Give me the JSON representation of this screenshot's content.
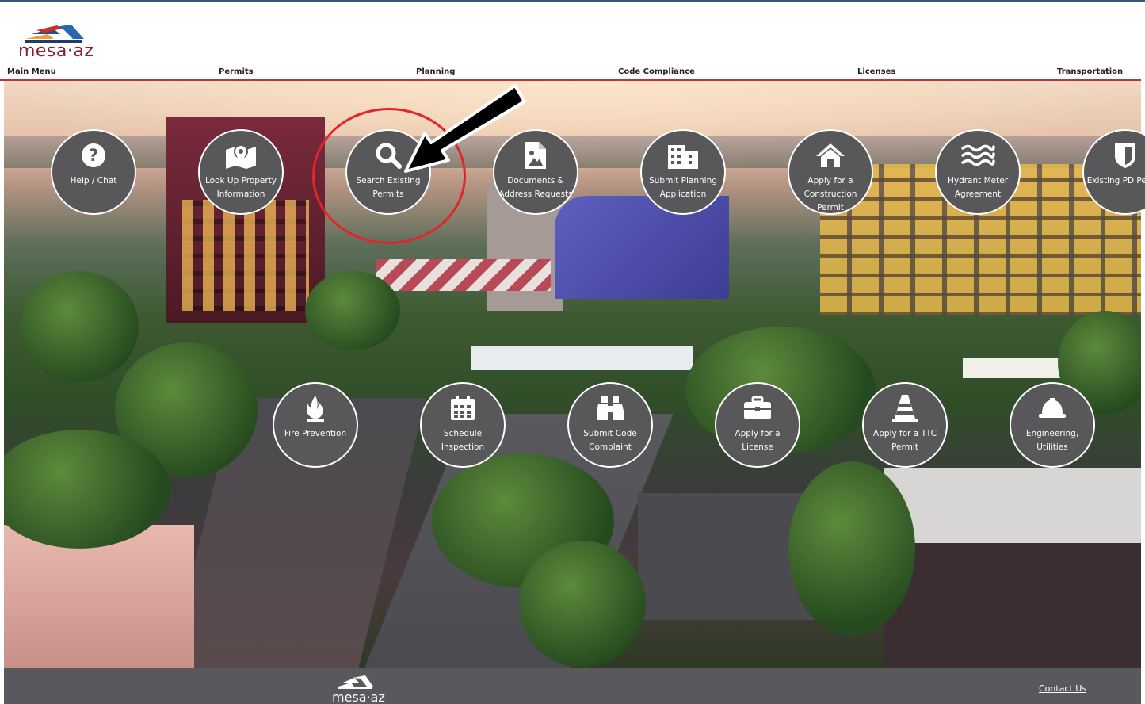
{
  "logo": {
    "text": "mesa·az",
    "footer_text": "mesa·az"
  },
  "nav": {
    "items": [
      {
        "label": "Main Menu"
      },
      {
        "label": "Permits"
      },
      {
        "label": "Planning"
      },
      {
        "label": "Code Compliance"
      },
      {
        "label": "Licenses"
      },
      {
        "label": "Transportation"
      }
    ]
  },
  "tiles_top": [
    {
      "label": "Help / Chat",
      "icon": "question-icon"
    },
    {
      "label": "Look Up Property Information",
      "icon": "map-pin-icon"
    },
    {
      "label": "Search Existing Permits",
      "icon": "search-icon"
    },
    {
      "label": "Documents & Address Requests",
      "icon": "document-image-icon"
    },
    {
      "label": "Submit Planning Application",
      "icon": "buildings-icon"
    },
    {
      "label": "Apply for a Construction Permit",
      "icon": "home-icon"
    },
    {
      "label": "Hydrant Meter Agreement",
      "icon": "water-waves-icon"
    },
    {
      "label": "Existing PD Permit",
      "icon": "shield-icon"
    }
  ],
  "tiles_bottom": [
    {
      "label": "Fire Prevention",
      "icon": "fire-icon"
    },
    {
      "label": "Schedule Inspection",
      "icon": "calendar-icon"
    },
    {
      "label": "Submit Code Complaint",
      "icon": "binoculars-icon"
    },
    {
      "label": "Apply for a License",
      "icon": "briefcase-icon"
    },
    {
      "label": "Apply for a TTC Permit",
      "icon": "traffic-cone-icon"
    },
    {
      "label": "Engineering, Utilities",
      "icon": "hard-hat-icon"
    }
  ],
  "footer": {
    "contact_label": "Contact Us"
  },
  "colors": {
    "brand_red": "#8b1d2c",
    "nav_rule": "#b53544",
    "tile_bg": "#58585a",
    "footer_bg": "#58585d",
    "highlight_ring": "#e0262b"
  }
}
